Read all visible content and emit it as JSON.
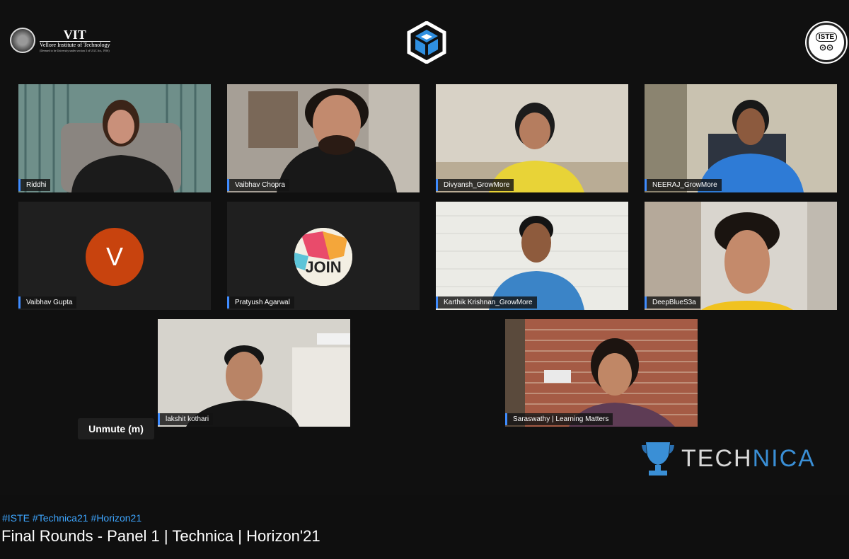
{
  "meeting": {
    "logos": {
      "vit": {
        "name": "VIT",
        "full": "Vellore Institute of Technology",
        "note": "(Deemed to be University under section 3 of UGC Act, 1956)"
      },
      "iste": {
        "name": "ISTE"
      },
      "event": {
        "name": "TECHNICA",
        "part_a": "TECH",
        "part_b": "NICA"
      }
    },
    "participants": [
      {
        "name": "Riddhi"
      },
      {
        "name": "Vaibhav Chopra"
      },
      {
        "name": "Divyansh_GrowMore"
      },
      {
        "name": "NEERAJ_GrowMore"
      },
      {
        "name": "Vaibhav Gupta",
        "avatar_letter": "V",
        "avatar_color": "#c8430e"
      },
      {
        "name": "Pratyush Agarwal",
        "avatar_text": "JOIN"
      },
      {
        "name": "Karthik Krishnan_GrowMore"
      },
      {
        "name": "DeepBlueS3a"
      },
      {
        "name": "lakshit kothari"
      },
      {
        "name": "Saraswathy | Learning Matters"
      }
    ],
    "unmute_label": "Unmute (m)"
  },
  "video": {
    "hashtags": [
      "#ISTE",
      "#Technica21",
      "#Horizon21"
    ],
    "title": "Final Rounds - Panel 1 | Technica | Horizon'21"
  },
  "colors": {
    "accent": "#3ea6ff",
    "name_bar": "#3f8cff",
    "technica_blue": "#3a8fd6"
  }
}
